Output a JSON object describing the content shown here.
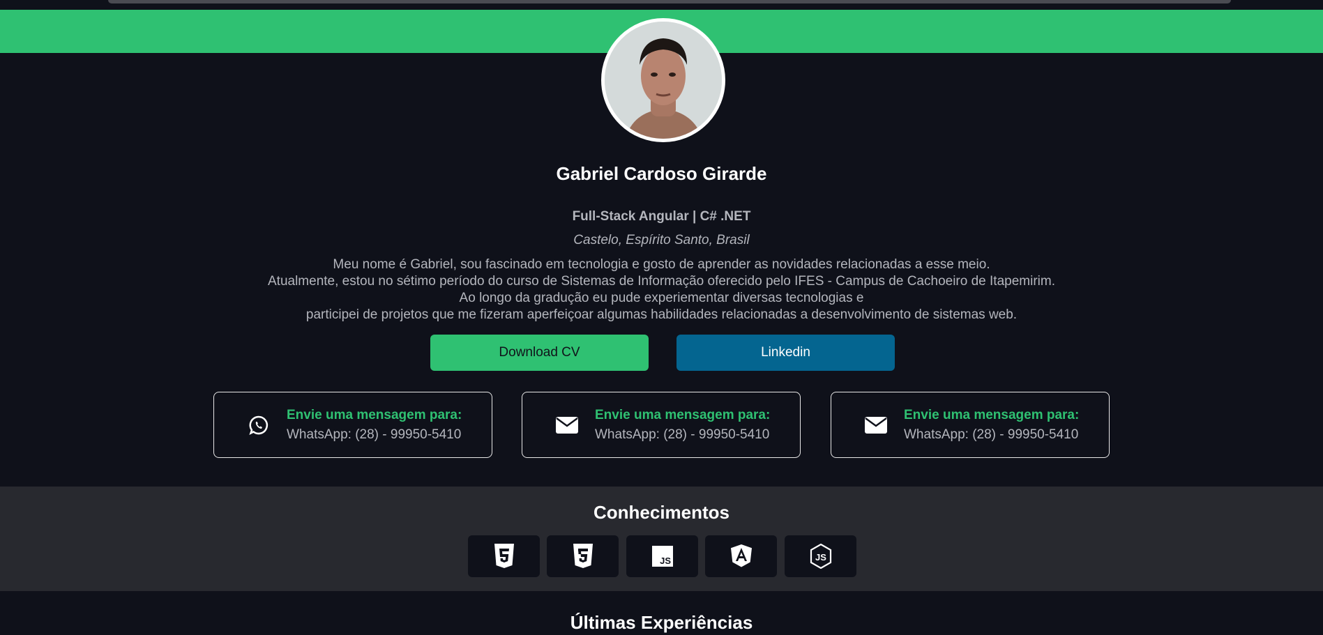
{
  "profile": {
    "name": "Gabriel Cardoso Girarde",
    "role": "Full-Stack Angular | C# .NET",
    "location": "Castelo, Espírito Santo, Brasil",
    "bio": [
      "Meu nome é Gabriel, sou fascinado em tecnologia e gosto de aprender as novidades relacionadas a esse meio.",
      "Atualmente, estou no sétimo período do curso de Sistemas de Informação oferecido pelo IFES - Campus de Cachoeiro de Itapemirim.",
      "Ao longo da gradução eu pude experiementar diversas tecnologias e",
      "participei de projetos que me fizeram aperfeiçoar algumas habilidades relacionadas a desenvolvimento de sistemas web."
    ]
  },
  "buttons": {
    "download_cv": "Download CV",
    "linkedin": "Linkedin"
  },
  "contacts": [
    {
      "icon": "whatsapp-icon",
      "title": "Envie uma mensagem para:",
      "value": "WhatsApp: (28) - 99950-5410"
    },
    {
      "icon": "envelope-icon",
      "title": "Envie uma mensagem para:",
      "value": "WhatsApp: (28) - 99950-5410"
    },
    {
      "icon": "envelope-icon",
      "title": "Envie uma mensagem para:",
      "value": "WhatsApp: (28) - 99950-5410"
    }
  ],
  "skills": {
    "title": "Conhecimentos",
    "items": [
      "html5-icon",
      "css3-icon",
      "javascript-icon",
      "angular-icon",
      "nodejs-icon"
    ]
  },
  "experience": {
    "title": "Últimas Experiências"
  },
  "colors": {
    "accent_green": "#2fc172",
    "linkedin_blue": "#046590",
    "background": "#0f111a",
    "section_gray": "#28292f"
  }
}
